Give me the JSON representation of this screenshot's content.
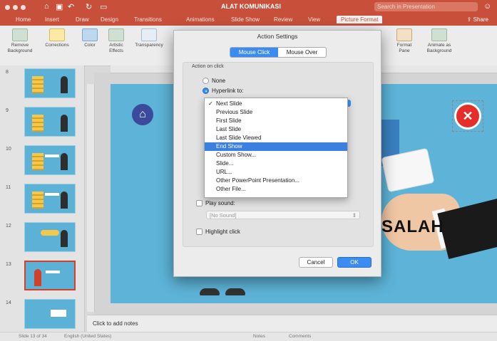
{
  "app": {
    "doc_title": "ALAT KOMUNIKASI",
    "search_placeholder": "Search in Presentation",
    "share_label": "Share"
  },
  "tabs": [
    {
      "label": "Home"
    },
    {
      "label": "Insert"
    },
    {
      "label": "Draw"
    },
    {
      "label": "Design"
    },
    {
      "label": "Transitions"
    },
    {
      "label": "Animations"
    },
    {
      "label": "Slide Show"
    },
    {
      "label": "Review"
    },
    {
      "label": "View"
    },
    {
      "label": "Picture Format"
    }
  ],
  "ribbon": {
    "remove_bg": "Remove Background",
    "corrections": "Corrections",
    "color": "Color",
    "artistic": "Artistic Effects",
    "transparency": "Transparency",
    "format_pane": "Format Pane",
    "animate_bg": "Animate as Background"
  },
  "thumbnails": [
    {
      "num": "8"
    },
    {
      "num": "9"
    },
    {
      "num": "10"
    },
    {
      "num": "11"
    },
    {
      "num": "12"
    },
    {
      "num": "13"
    },
    {
      "num": "14"
    }
  ],
  "slide": {
    "salah_text": "SALAH"
  },
  "notes": {
    "placeholder": "Click to add notes"
  },
  "status": {
    "slide_info": "Slide 13 of 34",
    "language": "English (United States)",
    "notes_btn": "Notes",
    "comments_btn": "Comments"
  },
  "dialog": {
    "title": "Action Settings",
    "tab_click": "Mouse Click",
    "tab_over": "Mouse Over",
    "group_label": "Action on click",
    "opt_none": "None",
    "opt_hyperlink": "Hyperlink to:",
    "play_sound": "Play sound:",
    "sound_value": "[No Sound]",
    "highlight_click": "Highlight click",
    "cancel": "Cancel",
    "ok": "OK"
  },
  "dropdown": {
    "selected": "Next Slide",
    "highlighted": "End Show",
    "items": [
      "Next Slide",
      "Previous Slide",
      "First Slide",
      "Last Slide",
      "Last Slide Viewed",
      "End Show",
      "Custom Show...",
      "Slide...",
      "URL...",
      "Other PowerPoint Presentation...",
      "Other File..."
    ]
  },
  "colors": {
    "accent": "#c8503a",
    "selection_blue": "#3b8cf2",
    "slide_bg": "#5db4d8"
  }
}
